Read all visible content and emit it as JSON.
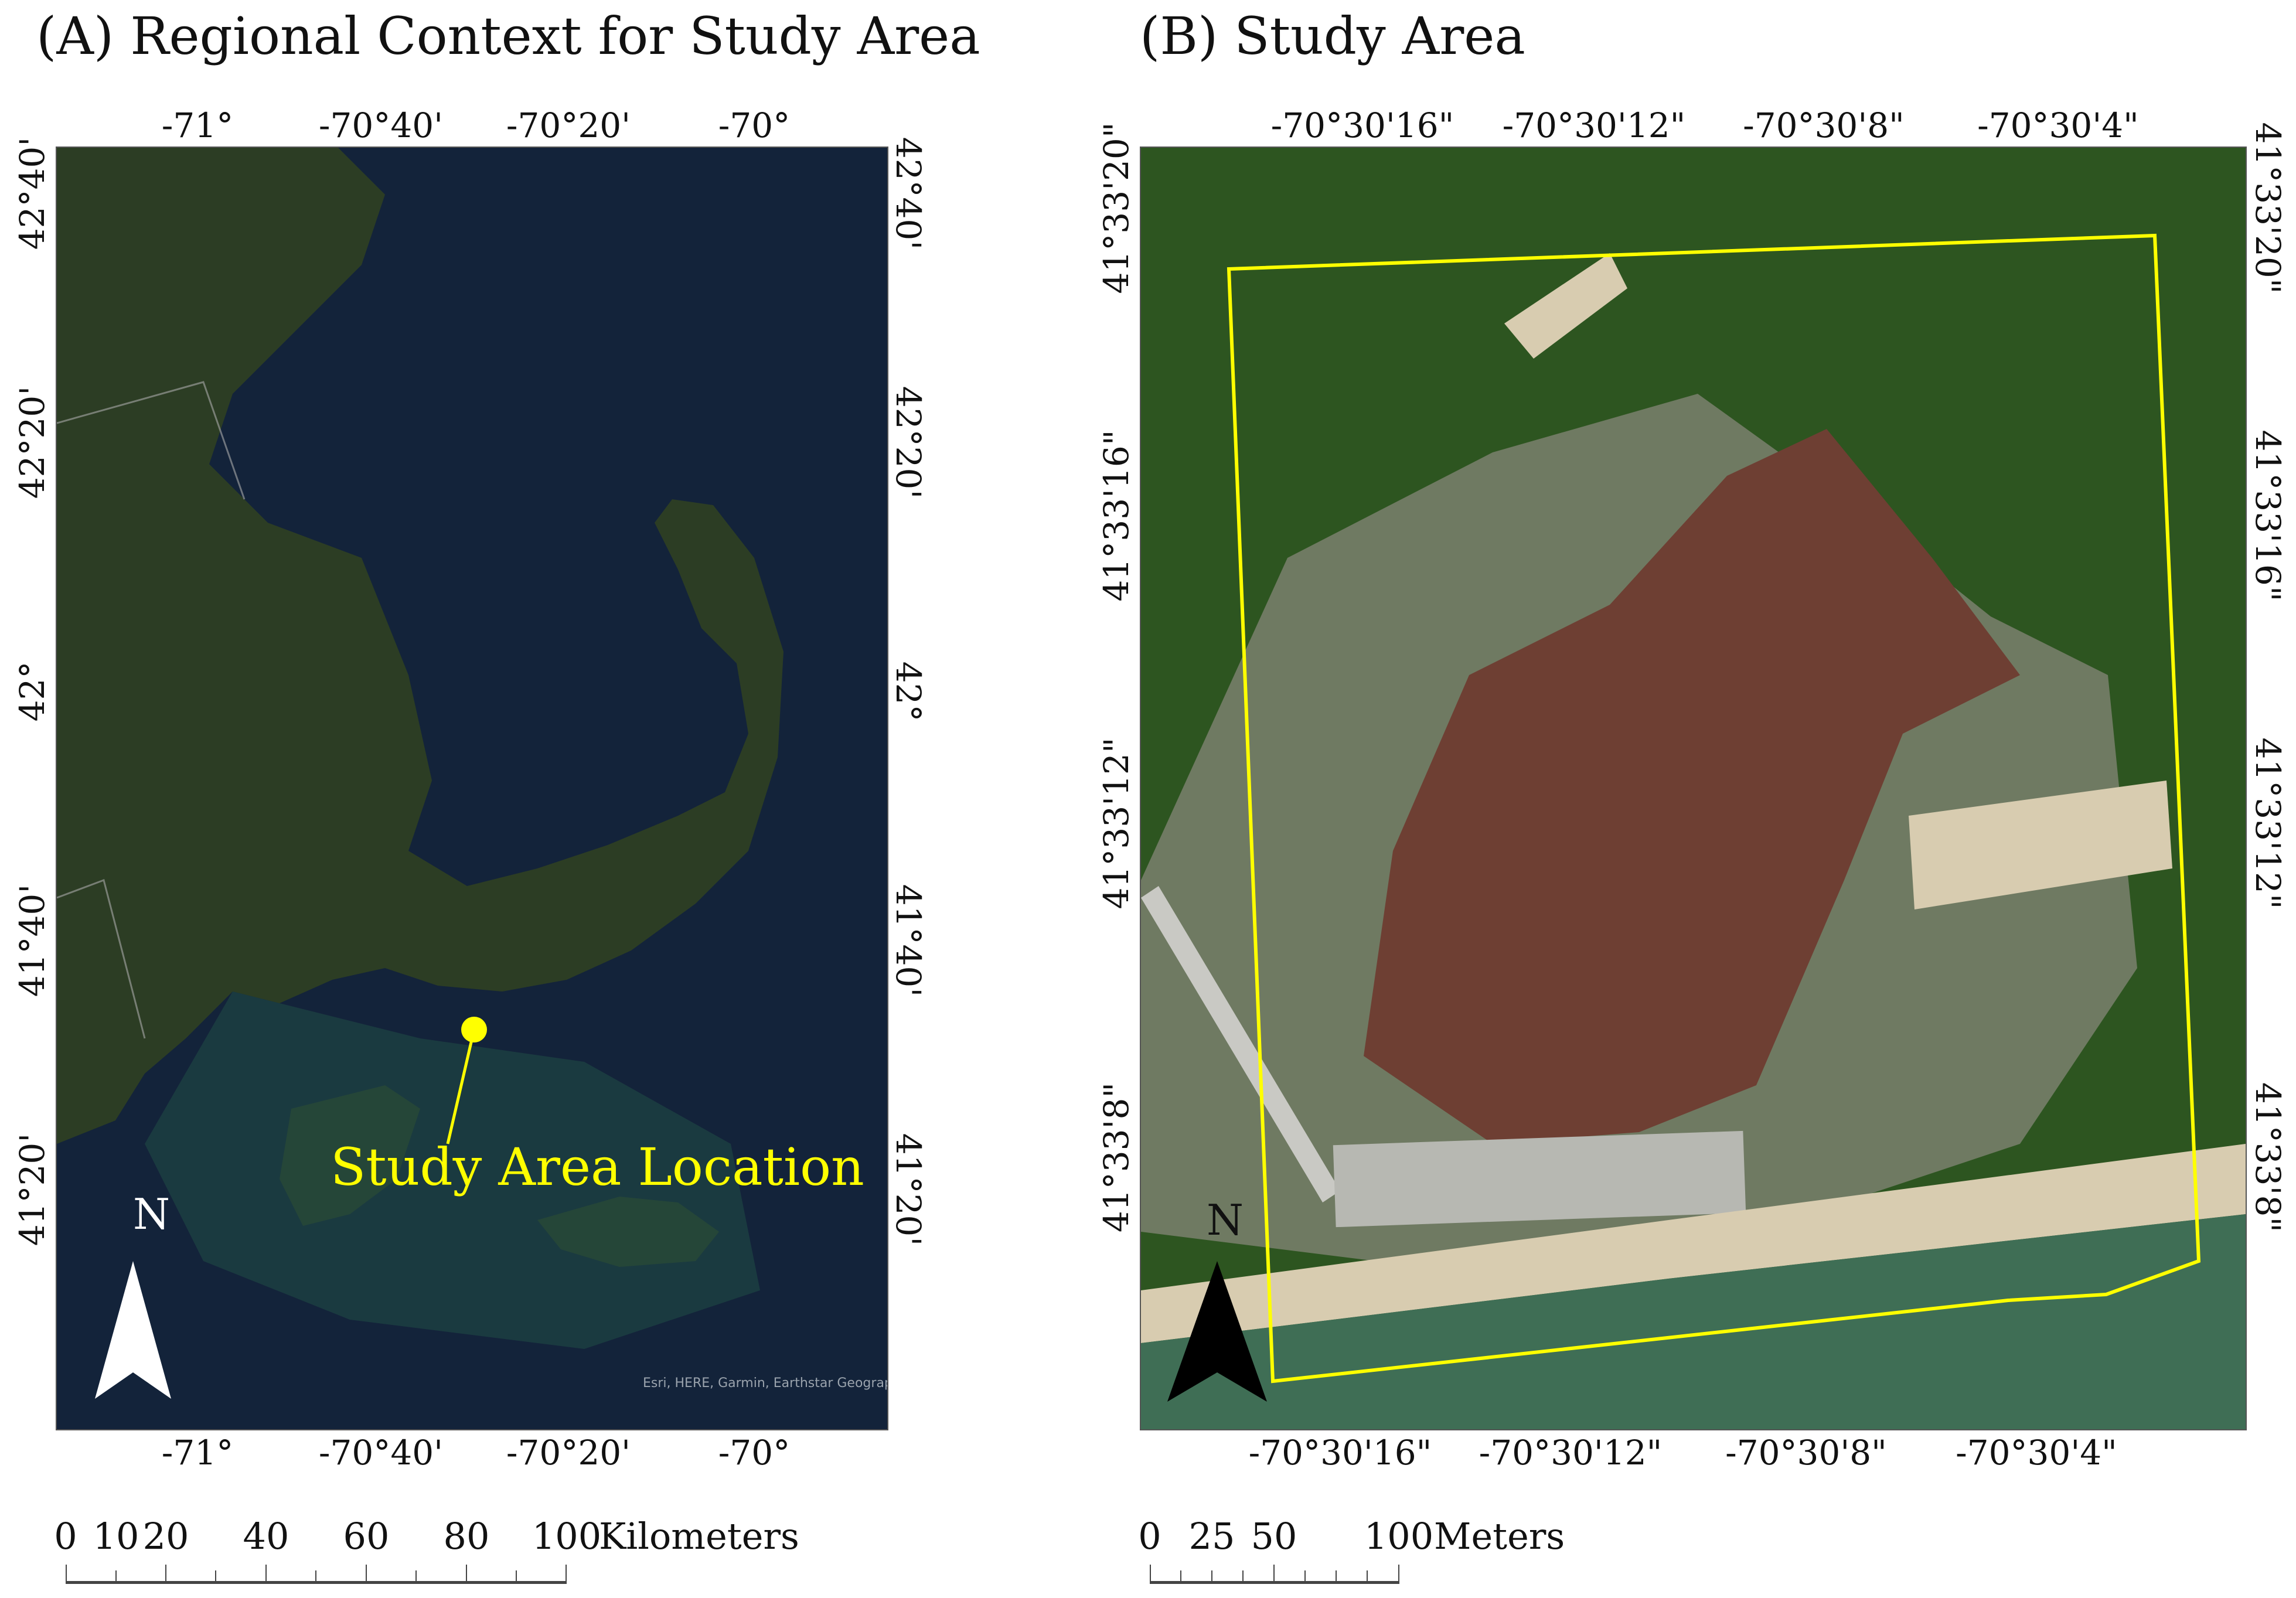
{
  "panel_a": {
    "title": "(A) Regional Context for Study Area",
    "top_ticks": [
      "-71°",
      "-70°40'",
      "-70°20'",
      "-70°"
    ],
    "bottom_ticks": [
      "-71°",
      "-70°40'",
      "-70°20'",
      "-70°"
    ],
    "left_ticks": [
      "42°40'",
      "42°20'",
      "42°",
      "41°40'",
      "41°20'"
    ],
    "right_ticks": [
      "42°40'",
      "42°20'",
      "42°",
      "41°40'",
      "41°20'"
    ],
    "annotation": "Study Area Location",
    "attribution": "Esri, HERE, Garmin, Earthstar Geographics",
    "north_label": "N",
    "scale_labels": [
      "0",
      "10",
      "20",
      "40",
      "60",
      "80",
      "100"
    ],
    "scale_unit": "Kilometers",
    "colors": {
      "water": "#13233a",
      "land": "#2c3d24",
      "annotation": "#ffff00"
    }
  },
  "panel_b": {
    "title": "(B) Study Area",
    "top_ticks": [
      "-70°30'16\"",
      "-70°30'12\"",
      "-70°30'8\"",
      "-70°30'4\""
    ],
    "bottom_ticks": [
      "-70°30'16\"",
      "-70°30'12\"",
      "-70°30'8\"",
      "-70°30'4\""
    ],
    "left_ticks": [
      "41°33'20\"",
      "41°33'16\"",
      "41°33'12\"",
      "41°33'8\""
    ],
    "right_ticks": [
      "41°33'20\"",
      "41°33'16\"",
      "41°33'12\"",
      "41°33'8\""
    ],
    "north_label": "N",
    "scale_labels": [
      "0",
      "25",
      "50",
      "100"
    ],
    "scale_unit": "Meters",
    "colors": {
      "boundary": "#ffff00",
      "forest": "#2f5a22",
      "marsh": "#6e3f33",
      "water": "#3f6e55",
      "sand": "#d8ccb0"
    }
  }
}
